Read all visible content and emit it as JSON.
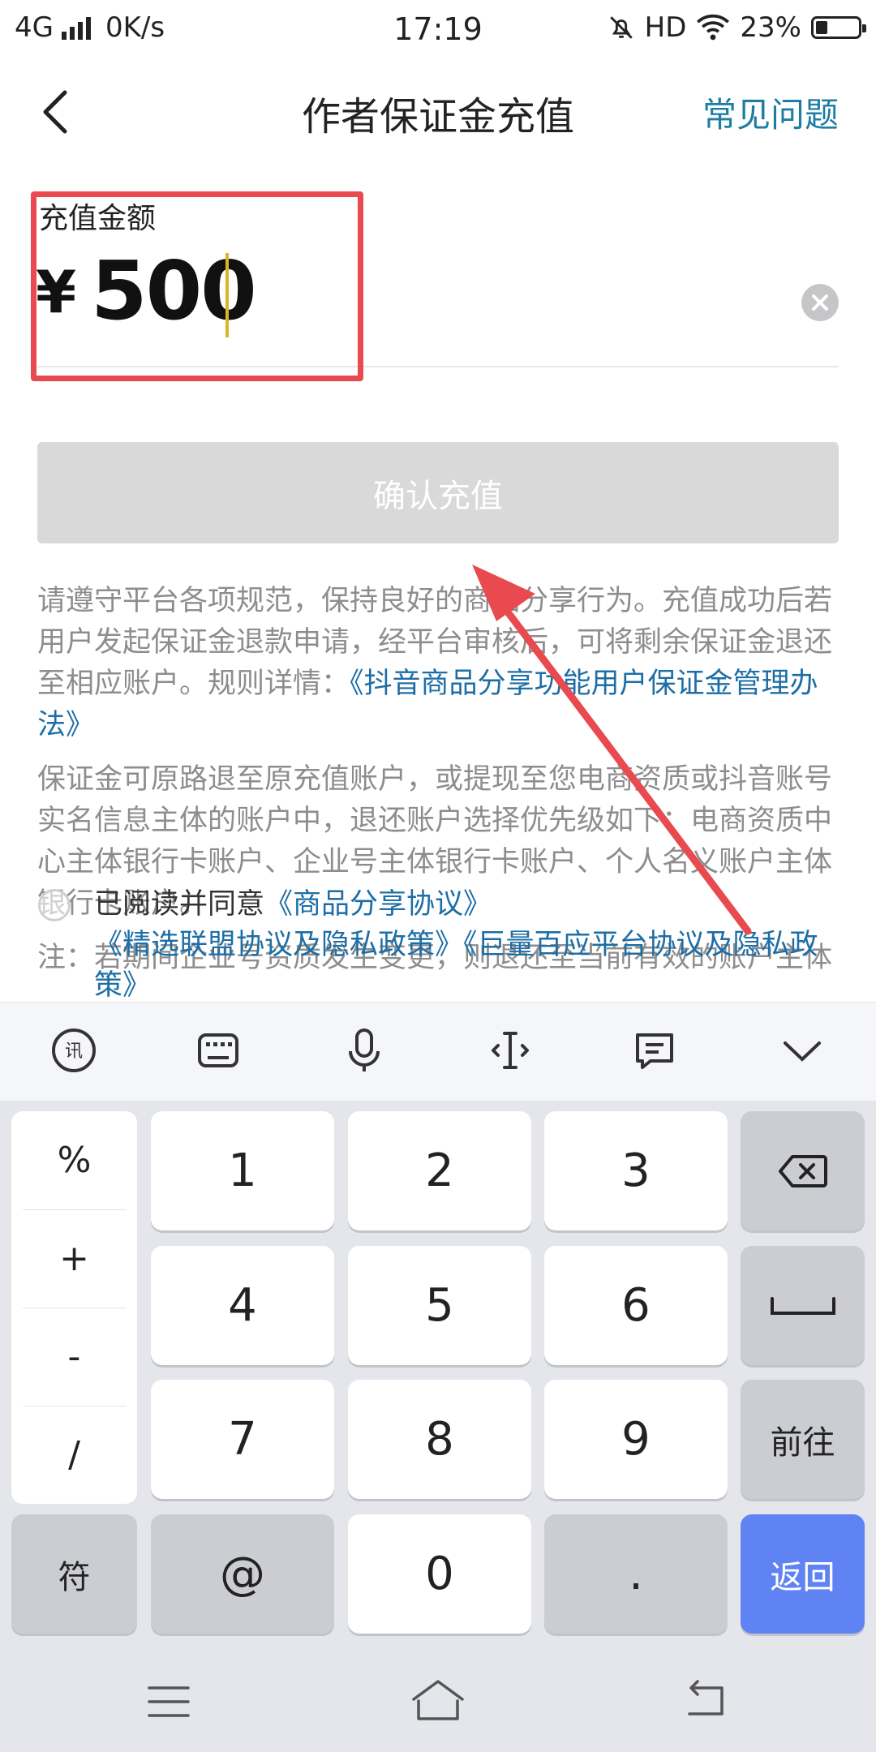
{
  "status_bar": {
    "network": "4G",
    "speed": "0K/s",
    "time": "17:19",
    "hd": "HD",
    "battery": "23%"
  },
  "header": {
    "title": "作者保证金充值",
    "faq": "常见问题"
  },
  "amount_section": {
    "label": "充值金额",
    "currency": "¥",
    "value": "500"
  },
  "confirm_button": "确认充值",
  "rules": {
    "p1_text": "请遵守平台各项规范，保持良好的商品分享行为。充值成功后若用户发起保证金退款申请，经平台审核后，可将剩余保证金退还至相应账户。规则详情：",
    "p1_link": "《抖音商品分享功能用户保证金管理办法》",
    "p2_text": "保证金可原路退至原充值账户，或提现至您电商资质或抖音账号实名信息主体的账户中，退还账户选择优先级如下：电商资质中心主体银行卡账户、企业号主体银行卡账户、个人名义账户主体银行卡账户。",
    "p3_text": "注：若期间企业号资质发生变更，则退还至当前有效的账户主体"
  },
  "agreement": {
    "prefix": "已阅读并同意",
    "link1": "《商品分享协议》",
    "link2": "《精选联盟协议及隐私政策》",
    "link3": "《巨量百应平台协议及隐私政策》"
  },
  "keyboard": {
    "symbols": [
      "%",
      "+",
      "-",
      "/"
    ],
    "digits": [
      "1",
      "2",
      "3",
      "4",
      "5",
      "6",
      "7",
      "8",
      "9"
    ],
    "fu": "符",
    "at": "@",
    "zero": "0",
    "dot": ".",
    "go": "前往",
    "back": "返回"
  },
  "colors": {
    "accent_link": "#1d6ea6",
    "highlight_red": "#e84a4f",
    "return_key_blue": "#5f83f3"
  }
}
